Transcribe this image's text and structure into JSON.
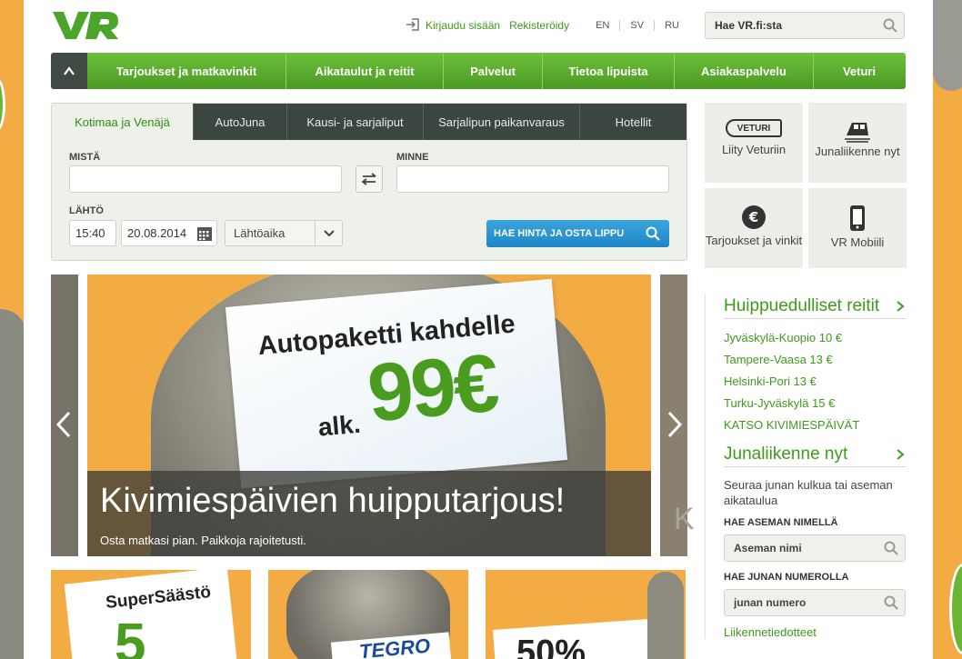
{
  "header": {
    "login": "Kirjaudu sisään",
    "register": "Rekisteröidy",
    "languages": [
      "EN",
      "SV",
      "RU"
    ],
    "search_placeholder": "Hae VR.fi:sta"
  },
  "nav": {
    "items": [
      "Tarjoukset ja matkavinkit",
      "Aikataulut ja reitit",
      "Palvelut",
      "Tietoa lipuista",
      "Asiakaspalvelu",
      "Veturi"
    ]
  },
  "booking": {
    "tabs": [
      "Kotimaa ja Venäjä",
      "AutoJuna",
      "Kausi- ja sarjaliput",
      "Sarjalipun paikanvaraus",
      "Hotellit"
    ],
    "from_label": "MISTÄ",
    "to_label": "MINNE",
    "depart_label": "LÄHTÖ",
    "time": "15:40",
    "date": "20.08.2014",
    "time_type": "Lähtöaika",
    "submit": "HAE HINTA JA OSTA LIPPU"
  },
  "hero": {
    "card_line1": "Autopaketti kahdelle",
    "card_price": "99€",
    "card_prefix": "alk.",
    "headline": "Kivimiespäivien huipputarjous!",
    "subline": "Osta matkasi pian. Paikkoja rajoitetusti.",
    "side_letter": "K"
  },
  "promos": {
    "p1": "SuperSäästö",
    "p1_big": "5",
    "p2": "TEGRO",
    "p3": "50%"
  },
  "tiles": [
    {
      "label": "Liity Veturiin",
      "badge": "VETURI"
    },
    {
      "label": "Junaliikenne nyt"
    },
    {
      "label": "Tarjoukset ja vinkit"
    },
    {
      "label": "VR Mobiili"
    }
  ],
  "sidebar": {
    "routes_title": "Huippuedulliset reitit",
    "routes": [
      "Jyväskylä-Kuopio 10 €",
      "Tampere-Vaasa 13 €",
      "Helsinki-Pori 13 €",
      "Turku-Jyväskylä 15 €",
      "KATSO KIVIMIESPÄIVÄT"
    ],
    "traffic_title": "Junaliikenne nyt",
    "traffic_desc": "Seuraa junan kulkua tai aseman aikataulua",
    "station_label": "HAE ASEMAN NIMELLÄ",
    "station_placeholder": "Aseman nimi",
    "train_label": "HAE JUNAN NUMEROLLA",
    "train_placeholder": "junan numero",
    "bulletins": "Liikennetiedotteet"
  },
  "colors": {
    "accent": "#4b9a22",
    "button_blue": "#1e86c6",
    "dark": "#3c4641"
  }
}
